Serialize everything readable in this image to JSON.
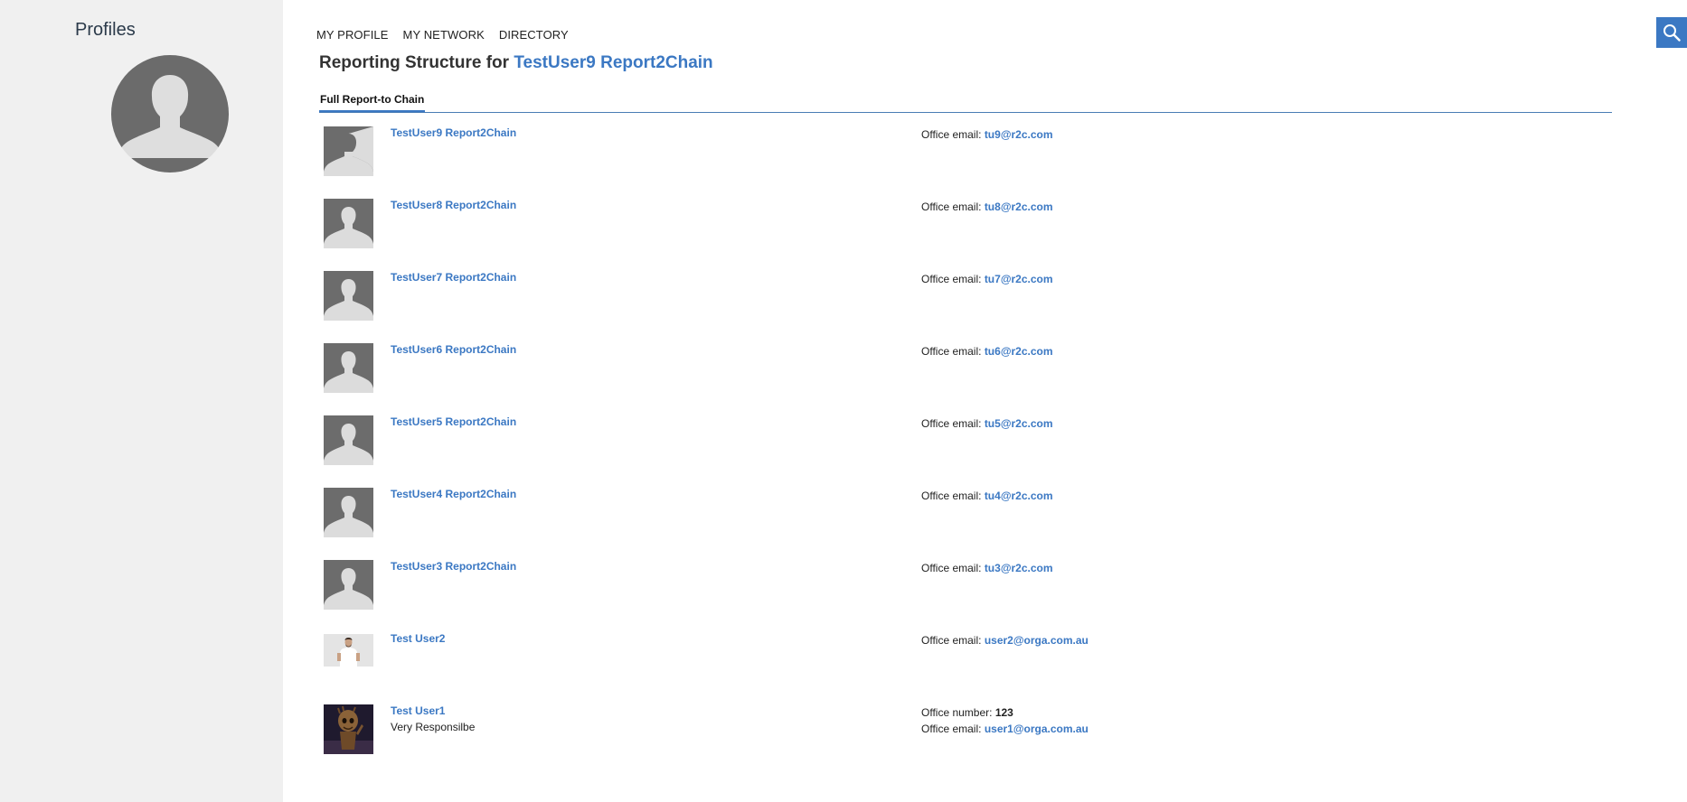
{
  "sidebar": {
    "title": "Profiles",
    "avatar_icon": "person-silhouette-icon"
  },
  "topnav": {
    "items": [
      "MY PROFILE",
      "MY NETWORK",
      "DIRECTORY"
    ]
  },
  "search": {
    "icon": "search-icon"
  },
  "heading": {
    "prefix": "Reporting Structure for",
    "name": "TestUser9 Report2Chain"
  },
  "tabs": {
    "active": "Full Report-to Chain"
  },
  "colors": {
    "accent": "#3b78c3",
    "sidebar_bg": "#f0f0f0"
  },
  "people": [
    {
      "name": "TestUser9 Report2Chain",
      "title": "",
      "email_label": "Office email:",
      "email": "tu9@r2c.com",
      "photo": "default-avatar"
    },
    {
      "name": "TestUser8 Report2Chain",
      "title": "",
      "email_label": "Office email:",
      "email": "tu8@r2c.com",
      "photo": "default-avatar"
    },
    {
      "name": "TestUser7 Report2Chain",
      "title": "",
      "email_label": "Office email:",
      "email": "tu7@r2c.com",
      "photo": "default-avatar"
    },
    {
      "name": "TestUser6 Report2Chain",
      "title": "",
      "email_label": "Office email:",
      "email": "tu6@r2c.com",
      "photo": "default-avatar"
    },
    {
      "name": "TestUser5 Report2Chain",
      "title": "",
      "email_label": "Office email:",
      "email": "tu5@r2c.com",
      "photo": "default-avatar"
    },
    {
      "name": "TestUser4 Report2Chain",
      "title": "",
      "email_label": "Office email:",
      "email": "tu4@r2c.com",
      "photo": "default-avatar"
    },
    {
      "name": "TestUser3 Report2Chain",
      "title": "",
      "email_label": "Office email:",
      "email": "tu3@r2c.com",
      "photo": "default-avatar"
    },
    {
      "name": "Test User2",
      "title": "",
      "email_label": "Office email:",
      "email": "user2@orga.com.au",
      "photo": "man-photo"
    },
    {
      "name": "Test User1",
      "title": "Very Responsilbe",
      "number_label": "Office number:",
      "number": "123",
      "email_label": "Office email:",
      "email": "user1@orga.com.au",
      "photo": "groot-photo"
    }
  ]
}
